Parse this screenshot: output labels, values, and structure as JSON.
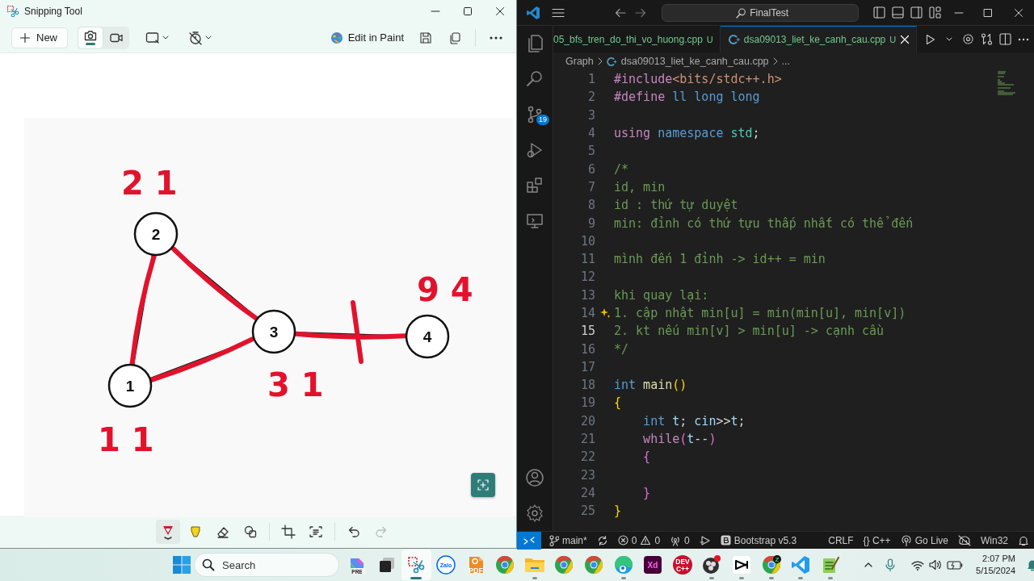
{
  "snipping_tool": {
    "title": "Snipping Tool",
    "new_button": "New",
    "modes": [
      {
        "kind": "photo",
        "selected": true
      },
      {
        "kind": "video",
        "selected": false
      }
    ],
    "edit_button": "Edit in Paint",
    "graph": {
      "nodes": [
        {
          "label": "1"
        },
        {
          "label": "2"
        },
        {
          "label": "3"
        },
        {
          "label": "4"
        }
      ],
      "annotations": [
        "2 1",
        "9 4",
        "3 1",
        "1 1"
      ]
    },
    "tools": [
      {
        "kind": "pen",
        "selected": true
      },
      {
        "kind": "highlighter",
        "selected": false
      },
      {
        "kind": "eraser",
        "selected": false
      },
      {
        "kind": "shapes",
        "selected": false
      }
    ],
    "actions": [
      {
        "kind": "crop",
        "disabled": false
      },
      {
        "kind": "text-actions",
        "disabled": false
      },
      {
        "kind": "undo",
        "disabled": false
      },
      {
        "kind": "redo",
        "disabled": true
      }
    ]
  },
  "vscode": {
    "search": "FinalTest",
    "activity_top": [
      {
        "kind": "explorer"
      },
      {
        "kind": "search"
      },
      {
        "kind": "source-control",
        "badge": "19"
      },
      {
        "kind": "run-debug"
      },
      {
        "kind": "extensions"
      },
      {
        "kind": "remote"
      }
    ],
    "activity_bottom": [
      {
        "kind": "account"
      },
      {
        "kind": "settings"
      }
    ],
    "tabs": [
      {
        "name": "05_bfs_tren_do_thi_vo_huong.cpp",
        "status": "U",
        "selected": false
      },
      {
        "name": "dsa09013_liet_ke_canh_cau.cpp",
        "status": "U",
        "selected": true
      }
    ],
    "breadcrumb": {
      "folder": "Graph",
      "file": "dsa09013_liet_ke_canh_cau.cpp",
      "more": "..."
    },
    "lines": [
      {
        "n": "1",
        "current": false,
        "hint": false,
        "tokens": [
          {
            "t": "#include",
            "kind": "directive"
          },
          {
            "t": "<bits/stdc++.h>",
            "kind": "string"
          }
        ]
      },
      {
        "n": "2",
        "current": false,
        "hint": false,
        "tokens": [
          {
            "t": "#define",
            "kind": "directive"
          },
          {
            "t": " ll long long",
            "kind": "type"
          }
        ]
      },
      {
        "n": "3",
        "current": false,
        "hint": false
      },
      {
        "n": "4",
        "current": false,
        "hint": false,
        "tokens": [
          {
            "t": "using",
            "kind": "keyword"
          },
          {
            "t": " namespace",
            "kind": "type"
          },
          {
            "t": " std",
            "kind": "namespace"
          },
          {
            "t": ";",
            "kind": "plain"
          }
        ]
      },
      {
        "n": "5",
        "current": false,
        "hint": false
      },
      {
        "n": "6",
        "current": false,
        "hint": false,
        "tokens": [
          {
            "t": "/*",
            "kind": "comment"
          }
        ]
      },
      {
        "n": "7",
        "current": false,
        "hint": false,
        "tokens": [
          {
            "t": "id, min",
            "kind": "comment"
          }
        ]
      },
      {
        "n": "8",
        "current": false,
        "hint": false,
        "tokens": [
          {
            "t": "id : thứ tự duyệt",
            "kind": "comment"
          }
        ]
      },
      {
        "n": "9",
        "current": false,
        "hint": false,
        "tokens": [
          {
            "t": "min: đỉnh có thứ tựu thấp nhất có thể đến",
            "kind": "comment"
          }
        ]
      },
      {
        "n": "10",
        "current": false,
        "hint": false
      },
      {
        "n": "11",
        "current": false,
        "hint": false,
        "tokens": [
          {
            "t": "mình đến 1 đỉnh -> id++ = min",
            "kind": "comment"
          }
        ]
      },
      {
        "n": "12",
        "current": false,
        "hint": false
      },
      {
        "n": "13",
        "current": false,
        "hint": false,
        "tokens": [
          {
            "t": "khi quay lại:",
            "kind": "comment"
          }
        ]
      },
      {
        "n": "14",
        "current": false,
        "hint": true,
        "tokens": [
          {
            "t": "1. cập nhật min[u] = min(min[u], min[v])",
            "kind": "comment"
          }
        ]
      },
      {
        "n": "15",
        "current": true,
        "hint": false,
        "tokens": [
          {
            "t": "2. kt nếu min[v] > min[u] -> cạnh cầu",
            "kind": "comment"
          }
        ]
      },
      {
        "n": "16",
        "current": false,
        "hint": false,
        "tokens": [
          {
            "t": "*/",
            "kind": "comment"
          }
        ]
      },
      {
        "n": "17",
        "current": false,
        "hint": false
      },
      {
        "n": "18",
        "current": false,
        "hint": false,
        "tokens": [
          {
            "t": "int",
            "kind": "type"
          },
          {
            "t": " main",
            "kind": "function"
          },
          {
            "t": "()",
            "kind": "bracket1"
          }
        ]
      },
      {
        "n": "19",
        "current": false,
        "hint": false,
        "tokens": [
          {
            "t": "{",
            "kind": "bracket1"
          }
        ]
      },
      {
        "n": "20",
        "current": false,
        "hint": false,
        "tokens": [
          {
            "t": "    int",
            "kind": "type"
          },
          {
            "t": " t",
            "kind": "variable"
          },
          {
            "t": "; ",
            "kind": "plain"
          },
          {
            "t": "cin",
            "kind": "variable"
          },
          {
            "t": ">>",
            "kind": "plain"
          },
          {
            "t": "t",
            "kind": "variable"
          },
          {
            "t": ";",
            "kind": "plain"
          }
        ]
      },
      {
        "n": "21",
        "current": false,
        "hint": false,
        "tokens": [
          {
            "t": "    while",
            "kind": "keyword"
          },
          {
            "t": "(",
            "kind": "bracket2"
          },
          {
            "t": "t",
            "kind": "variable"
          },
          {
            "t": "--",
            "kind": "plain"
          },
          {
            "t": ")",
            "kind": "bracket2"
          }
        ]
      },
      {
        "n": "22",
        "current": false,
        "hint": false,
        "tokens": [
          {
            "t": "    {",
            "kind": "bracket2"
          }
        ]
      },
      {
        "n": "23",
        "current": false,
        "hint": false
      },
      {
        "n": "24",
        "current": false,
        "hint": false,
        "tokens": [
          {
            "t": "    }",
            "kind": "bracket2"
          }
        ]
      },
      {
        "n": "25",
        "current": false,
        "hint": false,
        "tokens": [
          {
            "t": "}",
            "kind": "bracket1"
          }
        ]
      }
    ],
    "status_left": [
      {
        "kind": "branch",
        "text": "main*"
      },
      {
        "kind": "sync"
      },
      {
        "kind": "problems",
        "errors": "0",
        "warnings": "0"
      },
      {
        "kind": "ports",
        "text": "0"
      },
      {
        "kind": "run"
      },
      {
        "kind": "extension",
        "text": "Bootstrap v5.3"
      }
    ],
    "status_right": [
      {
        "kind": "text",
        "text": "CRLF"
      },
      {
        "kind": "language",
        "icon": "{}",
        "text": "C++"
      },
      {
        "kind": "live",
        "text": "Go Live"
      },
      {
        "kind": "copilot"
      },
      {
        "kind": "text",
        "text": "Win32"
      },
      {
        "kind": "bell"
      }
    ]
  },
  "taskbar": {
    "search_placeholder": "Search",
    "apps": [
      {
        "kind": "copilot",
        "label": "PRE",
        "running": false,
        "selected": false
      },
      {
        "kind": "task-view",
        "running": false,
        "selected": false
      },
      {
        "kind": "snipping",
        "running": true,
        "selected": true
      },
      {
        "kind": "zalo",
        "label": "Zalo",
        "running": false,
        "selected": false
      },
      {
        "kind": "pdf",
        "label": "PDF",
        "running": false,
        "selected": false
      },
      {
        "kind": "chrome",
        "running": false,
        "selected": false
      },
      {
        "kind": "files",
        "running": true,
        "selected": false
      },
      {
        "kind": "chrome",
        "running": false,
        "selected": false
      },
      {
        "kind": "chrome",
        "running": false,
        "selected": false
      },
      {
        "kind": "edge",
        "running": true,
        "selected": false
      },
      {
        "kind": "xd",
        "label": "Xd",
        "running": false,
        "selected": false
      },
      {
        "kind": "devcpp",
        "label": "DEV C++",
        "running": false,
        "selected": false
      },
      {
        "kind": "obs",
        "running": true,
        "selected": false
      },
      {
        "kind": "capcut",
        "running": true,
        "selected": false
      },
      {
        "kind": "chrome",
        "badge": "Z",
        "running": true,
        "selected": false
      },
      {
        "kind": "vscode",
        "running": true,
        "selected": false
      },
      {
        "kind": "notepad",
        "running": true,
        "selected": false
      }
    ],
    "time": "2:07 PM",
    "date": "5/15/2024"
  }
}
